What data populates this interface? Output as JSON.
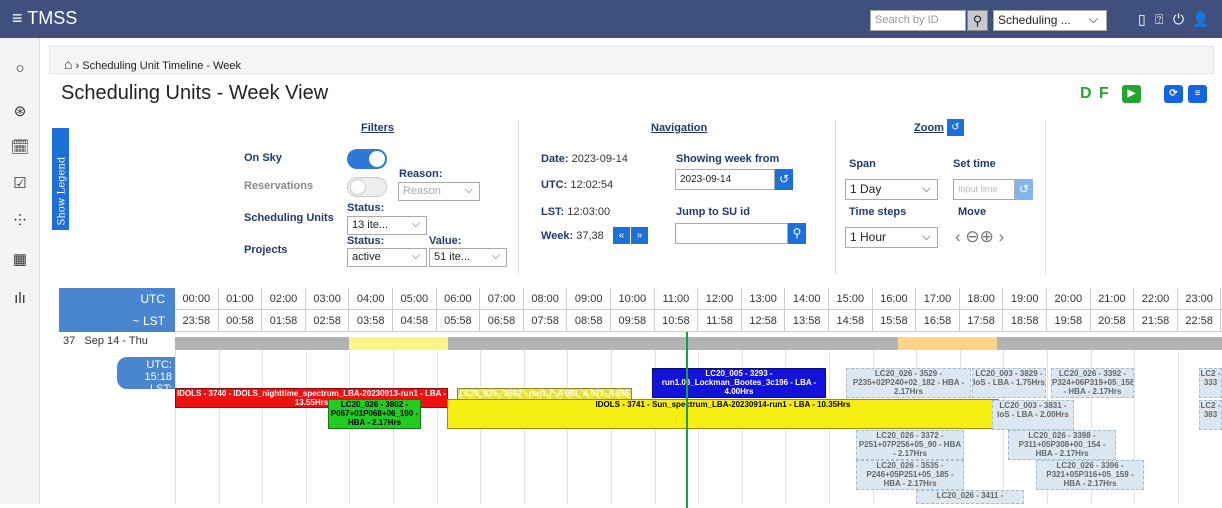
{
  "app": {
    "title": "TMSS",
    "menu_icon": "hamburger-icon"
  },
  "topbar": {
    "search_placeholder": "Search by ID",
    "select_value": "Scheduling ...",
    "icons": [
      "document-icon",
      "help-icon",
      "power-icon",
      "user-icon"
    ]
  },
  "sidebar": {
    "icons": [
      "refresh-icon",
      "dashboard-icon",
      "calendar-icon",
      "check-icon",
      "hierarchy-icon",
      "schedule-icon",
      "bar-chart-icon"
    ]
  },
  "breadcrumb": {
    "label": "Scheduling Unit Timeline - Week"
  },
  "page": {
    "title": "Scheduling Units - Week View",
    "actions": [
      "D",
      "F"
    ]
  },
  "legend": {
    "label": "Show Legend"
  },
  "filters": {
    "title": "Filters",
    "on_sky": "On Sky",
    "reservations": "Reservations",
    "reason_label": "Reason:",
    "reason_placeholder": "Reason",
    "scheduling_units": "Scheduling Units",
    "su_status_label": "Status:",
    "su_status_value": "13 ite...",
    "projects": "Projects",
    "proj_status_label": "Status:",
    "proj_status_value": "active",
    "value_label": "Value:",
    "value_value": "51 ite..."
  },
  "navigation": {
    "title": "Navigation",
    "date_label": "Date:",
    "date": "2023-09-14",
    "utc_label": "UTC:",
    "utc": "12:02:54",
    "lst_label": "LST:",
    "lst": "12:03:00",
    "week_label": "Week:",
    "week": "37,38",
    "showing_label": "Showing week from",
    "showing_value": "2023-09-14",
    "jump_label": "Jump to SU id"
  },
  "zoom": {
    "title": "Zoom",
    "span_label": "Span",
    "span_value": "1 Day",
    "set_time_label": "Set time",
    "set_time_placeholder": "Input time",
    "steps_label": "Time steps",
    "steps_value": "1 Hour",
    "move_label": "Move"
  },
  "timeline": {
    "utc_label": "UTC",
    "lst_label": "~ LST",
    "utc_hours": [
      "00:00",
      "01:00",
      "02:00",
      "03:00",
      "04:00",
      "05:00",
      "06:00",
      "07:00",
      "08:00",
      "09:00",
      "10:00",
      "11:00",
      "12:00",
      "13:00",
      "14:00",
      "15:00",
      "16:00",
      "17:00",
      "18:00",
      "19:00",
      "20:00",
      "21:00",
      "22:00",
      "23:00"
    ],
    "lst_hours": [
      "23:58",
      "00:58",
      "01:58",
      "02:58",
      "03:58",
      "04:58",
      "05:58",
      "06:58",
      "07:58",
      "08:58",
      "09:58",
      "10:58",
      "11:58",
      "12:58",
      "13:58",
      "14:58",
      "15:58",
      "16:58",
      "17:58",
      "18:58",
      "19:58",
      "20:58",
      "21:58",
      "22:58"
    ],
    "row_week": "37",
    "row_day": "Sep 14 - Thu",
    "now_utc": "UTC: 15:18",
    "now_lst": "LST: 15:16",
    "bars": [
      {
        "text": "IDOLS - 3740 - IDOLS_nighttime_spectrum_LBA-20230913-run1 - LBA - 13.55Hrs",
        "bg": "#ee1111",
        "fg": "#ffffff"
      },
      {
        "text": "LC20_035 - 3602 - run1.7_A 961_A 071_A 655 - LBA - 4.00Hrs",
        "bg": "#e8e020",
        "fg": "#ffffff"
      },
      {
        "text": "LC20_005 - 3293 - run1.08_Lockman_Bootes_3c196 - LBA - 4.00Hrs",
        "bg": "#1212d8",
        "fg": "#ffffff"
      },
      {
        "text": "LC20_026 - 3802 - P067+01P068+06_190 - HBA - 2.17Hrs",
        "bg": "#22cc22",
        "fg": "#000000"
      },
      {
        "text": "IDOLS - 3741 - Sun_spectrum_LBA-20230914-run1 - LBA - 10.35Hrs",
        "bg": "#f5ee10",
        "fg": "#000000"
      },
      {
        "text": "LC20_026 - 3529 - P235+02P240+02_182 - HBA - 2.17Hrs"
      },
      {
        "text": "LC20_003 - 3829 - IoS - LBA - 1.75Hrs"
      },
      {
        "text": "LC20_026 - 3392 - P324+06P319+05_158 - HBA - 2.17Hrs"
      },
      {
        "text": "LC20_003 - 3831 - IoS - LBA - 2.00Hrs"
      },
      {
        "text": "LC20_026 - 3372 - P251+07P256+05_90 - HBA - 2.17Hrs"
      },
      {
        "text": "LC20_026 - 3398 - P311+05P308+00_154 - HBA - 2.17Hrs"
      },
      {
        "text": "LC20_026 - 3535 - P246+05P251+05_185 - HBA - 2.17Hrs"
      },
      {
        "text": "LC20_026 - 3396 - P321+05P316+05_159 - HBA - 2.17Hrs"
      },
      {
        "text": "LC20_026 - 3411 -"
      },
      {
        "text": "LC2 - 333"
      },
      {
        "text": "LC2 - 383"
      }
    ]
  }
}
